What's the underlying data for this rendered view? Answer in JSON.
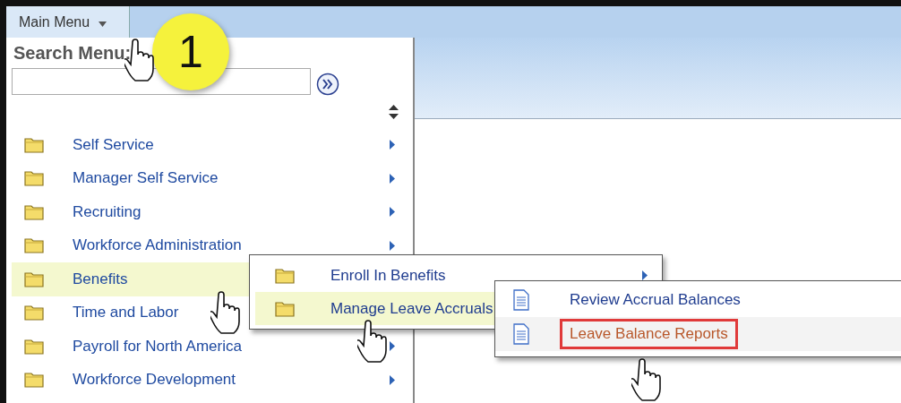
{
  "menu_button": {
    "label": "Main Menu"
  },
  "step_badge": "1",
  "search": {
    "title": "Search Menu:"
  },
  "menu_items": [
    {
      "label": "Self Service",
      "selected": false
    },
    {
      "label": "Manager Self Service",
      "selected": false
    },
    {
      "label": "Recruiting",
      "selected": false
    },
    {
      "label": "Workforce Administration",
      "selected": false
    },
    {
      "label": "Benefits",
      "selected": true
    },
    {
      "label": "Time and Labor",
      "selected": false
    },
    {
      "label": "Payroll for North America",
      "selected": false
    },
    {
      "label": "Workforce Development",
      "selected": false
    }
  ],
  "submenu": [
    {
      "kind": "folder",
      "label": "Enroll In Benefits",
      "selected": false
    },
    {
      "kind": "folder",
      "label": "Manage Leave Accruals",
      "selected": true
    }
  ],
  "subsubmenu": [
    {
      "kind": "document",
      "label": "Review Accrual Balances",
      "selected": false,
      "outlined": false
    },
    {
      "kind": "document",
      "label": "Leave Balance Reports",
      "selected": true,
      "outlined": true
    }
  ]
}
